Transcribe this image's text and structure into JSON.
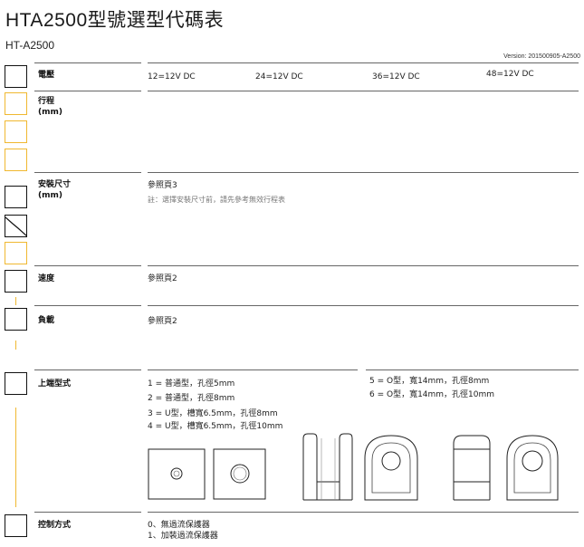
{
  "header": {
    "title": "HTA2500型號選型代碼表",
    "model": "HT-A2500",
    "version": "Version: 201500905-A2500"
  },
  "voltage": {
    "label": "電壓",
    "options": [
      "12=12V DC",
      "24=12V DC",
      "36=12V DC",
      "48=12V DC"
    ]
  },
  "stroke": {
    "label": "行程\n(mm)"
  },
  "mount": {
    "label": "安裝尺寸\n(mm)",
    "ref": "參照頁3",
    "note": "註：選擇安裝尺寸前，請先參考無效行程表"
  },
  "speed": {
    "label": "速度",
    "ref": "參照頁2"
  },
  "load": {
    "label": "負載",
    "ref": "參照頁2"
  },
  "top_end": {
    "label": "上端型式",
    "options_left": [
      "1 = 普通型，孔徑5mm",
      "2 = 普通型，孔徑8mm",
      "3 = U型，槽寬6.5mm，孔徑8mm",
      "4 = U型，槽寬6.5mm，孔徑10mm"
    ],
    "options_right": [
      "5 = O型，寬14mm，孔徑8mm",
      "6 = O型，寬14mm，孔徑10mm"
    ]
  },
  "control": {
    "label": "控制方式",
    "options": [
      "0、無過流保護器",
      "1、加裝過流保護器"
    ]
  }
}
